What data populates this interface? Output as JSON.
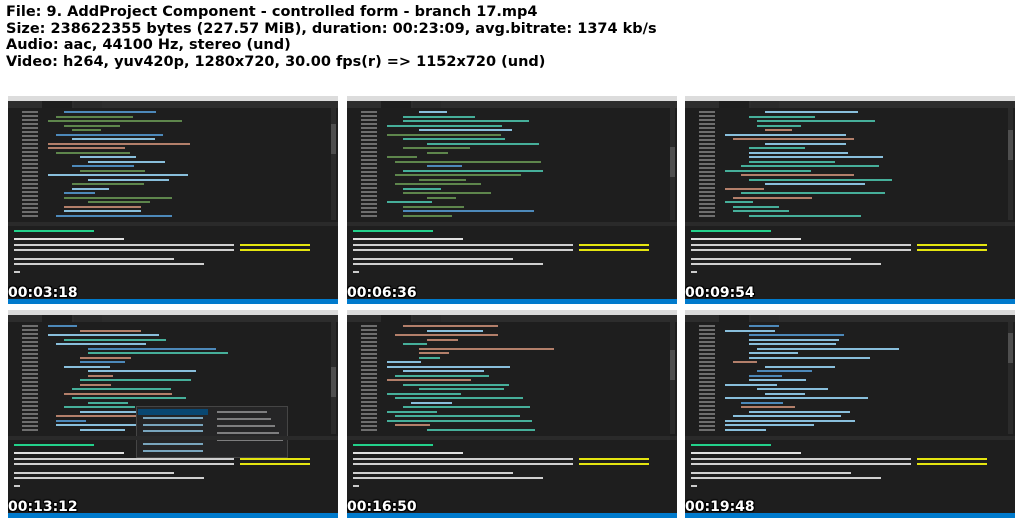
{
  "file_info": {
    "line1": "File: 9. AddProject Component - controlled form - branch 17.mp4",
    "line2": "Size: 238622355 bytes (227.57 MiB), duration: 00:23:09, avg.bitrate: 1374 kb/s",
    "line3": "Audio: aac, 44100 Hz, stereo (und)",
    "line4": "Video: h264, yuv420p, 1280x720, 30.00 fps(r) => 1152x720 (und)"
  },
  "thumbnails": [
    {
      "timestamp": "00:03:18"
    },
    {
      "timestamp": "00:06:36"
    },
    {
      "timestamp": "00:09:54"
    },
    {
      "timestamp": "00:13:12"
    },
    {
      "timestamp": "00:16:50"
    },
    {
      "timestamp": "00:19:48"
    }
  ],
  "colors": {
    "editor_bg": "#1e1e1e",
    "keyword": "#569cd6",
    "string": "#ce9178",
    "comment": "#6a9955",
    "tag": "#4ec9b0",
    "attr": "#9cdcfe",
    "terminal_warn": "#e5e510",
    "terminal_green": "#23d18b",
    "status_bar": "#007acc"
  }
}
